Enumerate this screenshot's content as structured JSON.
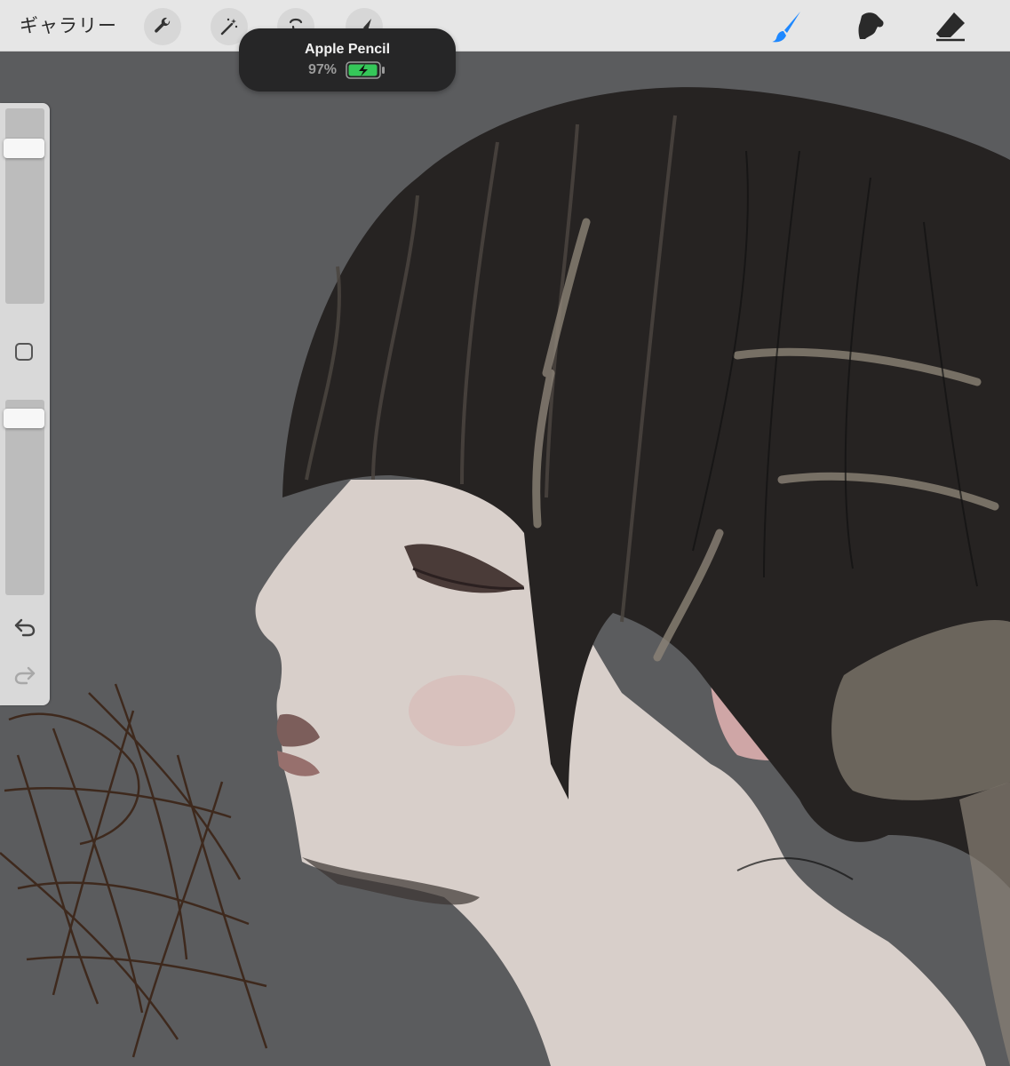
{
  "toolbar": {
    "gallery_label": "ギャラリー",
    "left_tools": [
      "wrench-icon",
      "magic-wand-icon",
      "selection-icon",
      "transform-arrow-icon"
    ],
    "right_tools": [
      "brush-icon",
      "smudge-icon",
      "eraser-icon"
    ],
    "active_tool": "brush",
    "accent_color": "#1e88ff"
  },
  "pencil_hud": {
    "title": "Apple Pencil",
    "battery_percent": "97%",
    "battery_level": 0.97,
    "battery_color": "#35c759",
    "state": "charging"
  },
  "sidebar": {
    "brush_size_level": 0.83,
    "opacity_level": 0.95,
    "undo_icon": "undo-icon",
    "redo_icon": "redo-icon",
    "modify_icon": "square-modify-icon"
  },
  "canvas": {
    "background_color": "#5b5c5e"
  }
}
